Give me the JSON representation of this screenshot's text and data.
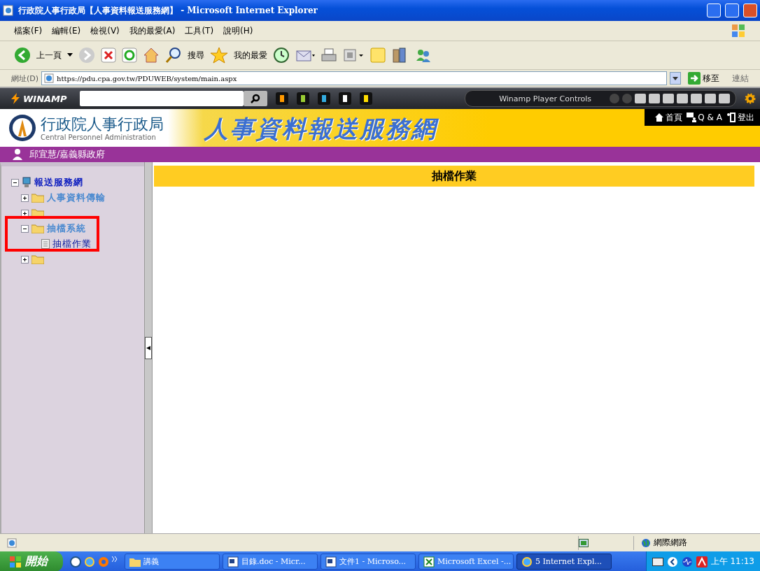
{
  "window": {
    "title": "行政院人事行政局【人事資料報送服務網】 - Microsoft Internet Explorer"
  },
  "menu": [
    "檔案(F)",
    "編輯(E)",
    "檢視(V)",
    "我的最愛(A)",
    "工具(T)",
    "說明(H)"
  ],
  "toolbar": {
    "back": "上一頁",
    "search": "搜尋",
    "favorites": "我的最愛"
  },
  "address": {
    "label": "網址(D)",
    "value": "https://pdu.cpa.gov.tw/PDUWEB/system/main.aspx",
    "go": "移至",
    "links": "連結"
  },
  "winamp": {
    "logo": "WINAMP",
    "controls_label": "Winamp Player Controls"
  },
  "site": {
    "org_name": "行政院人事行政局",
    "org_name_en": "Central Personnel Administration",
    "banner_title": "人事資料報送服務網",
    "links": [
      {
        "kind": "home",
        "label": "首頁"
      },
      {
        "kind": "qa",
        "label": "Q & A"
      },
      {
        "kind": "logout",
        "label": "登出"
      }
    ],
    "user": "邱宜慧/嘉義縣政府"
  },
  "tree": [
    {
      "label": "報送服務網",
      "kind": "root",
      "expanded": true,
      "children": [
        {
          "label": "人事資料傳輸",
          "kind": "folder",
          "expanded": false
        },
        {
          "kind": "folder",
          "expanded": false
        },
        {
          "label": "抽檔系統",
          "kind": "folder",
          "expanded": true,
          "children": [
            {
              "label": "抽檔作業",
              "kind": "page"
            }
          ]
        },
        {
          "kind": "folder",
          "expanded": false
        }
      ]
    }
  ],
  "content": {
    "heading": "抽檔作業"
  },
  "status_bar": {
    "zone": "網際網路"
  },
  "taskbar": {
    "start": "開始",
    "items": [
      {
        "kind": "folder",
        "label": "講義",
        "selected": false
      },
      {
        "kind": "word",
        "label": "目錄.doc - Micr...",
        "selected": false
      },
      {
        "kind": "word",
        "label": "文件1 - Microso...",
        "selected": false
      },
      {
        "kind": "excel",
        "label": "Microsoft Excel -...",
        "selected": false
      },
      {
        "kind": "ie",
        "label": "5 Internet Expl...",
        "selected": true
      }
    ],
    "clock": "上午 11:13"
  }
}
